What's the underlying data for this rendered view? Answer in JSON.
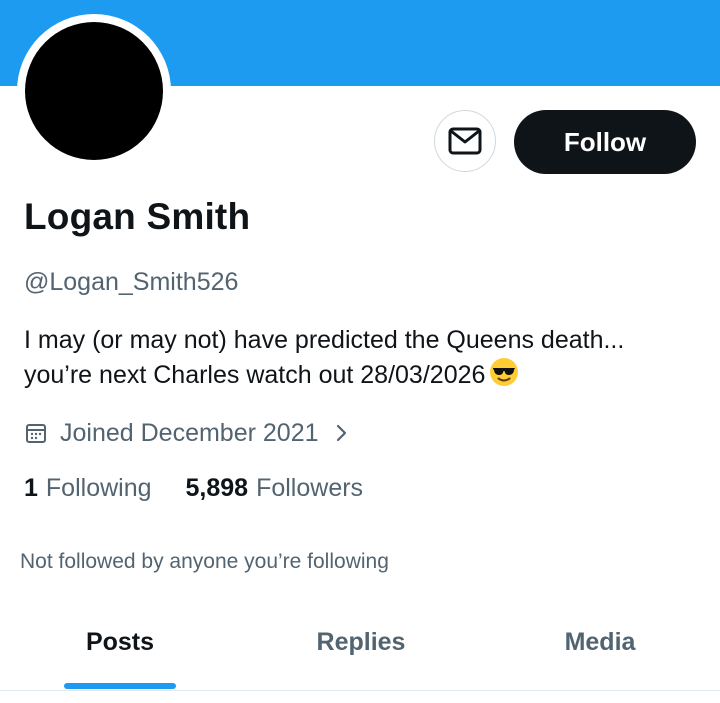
{
  "profile": {
    "name": "Logan Smith",
    "handle": "@Logan_Smith526",
    "bio_line1": "I may (or may not) have predicted the Queens death...",
    "bio_line2": "you’re next Charles watch out 28/03/2026",
    "bio_emoji": "smiling-face-with-sunglasses",
    "joined": "Joined December 2021",
    "following_count": "1",
    "following_label": "Following",
    "followers_count": "5,898",
    "followers_label": "Followers",
    "not_followed_note": "Not followed by anyone you’re following"
  },
  "actions": {
    "follow_label": "Follow",
    "message_icon": "envelope-icon"
  },
  "tabs": [
    {
      "label": "Posts",
      "active": true
    },
    {
      "label": "Replies",
      "active": false
    },
    {
      "label": "Media",
      "active": false
    }
  ],
  "colors": {
    "banner": "#1d9bf0",
    "accent": "#1d9bf0",
    "text_primary": "#0f1419",
    "text_secondary": "#536471"
  }
}
